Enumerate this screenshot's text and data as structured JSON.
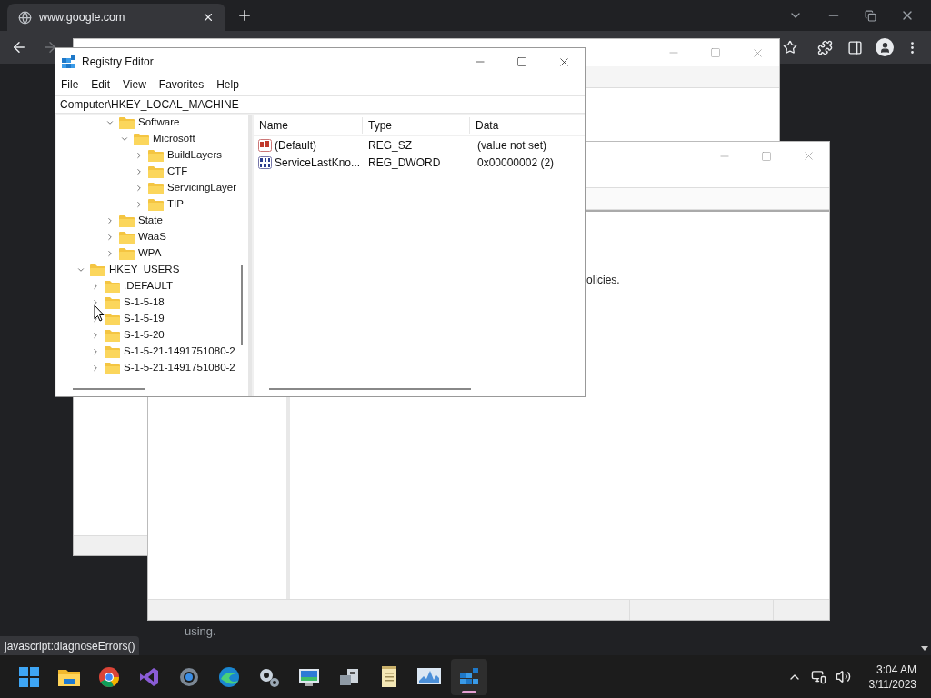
{
  "browser": {
    "tab": {
      "title": "www.google.com"
    },
    "forward_disabled": true,
    "page_text": "using.",
    "status_text": "javascript:diagnoseErrors()"
  },
  "back_window": {
    "text": "olicies."
  },
  "registry_editor": {
    "title": "Registry Editor",
    "menu": [
      "File",
      "Edit",
      "View",
      "Favorites",
      "Help"
    ],
    "address": "Computer\\HKEY_LOCAL_MACHINE",
    "tree": {
      "scrolled_branch": [
        {
          "label": "Software",
          "expanded": true,
          "children": [
            {
              "label": "Microsoft",
              "expanded": true,
              "children": [
                {
                  "label": "BuildLayers",
                  "expanded": false
                },
                {
                  "label": "CTF",
                  "expanded": false
                },
                {
                  "label": "ServicingLayer",
                  "expanded": false
                },
                {
                  "label": "TIP",
                  "expanded": false
                }
              ]
            }
          ]
        },
        {
          "label": "State",
          "expanded": false
        },
        {
          "label": "WaaS",
          "expanded": false
        },
        {
          "label": "WPA",
          "expanded": false
        }
      ],
      "roots": [
        {
          "label": "HKEY_USERS",
          "expanded": true,
          "children": [
            {
              "label": ".DEFAULT",
              "expanded": false
            },
            {
              "label": "S-1-5-18",
              "expanded": false
            },
            {
              "label": "S-1-5-19",
              "expanded": false
            },
            {
              "label": "S-1-5-20",
              "expanded": false
            },
            {
              "label": "S-1-5-21-1491751080-2",
              "expanded": false
            },
            {
              "label": "S-1-5-21-1491751080-2",
              "expanded": false
            }
          ]
        }
      ]
    },
    "columns": [
      "Name",
      "Type",
      "Data"
    ],
    "values": [
      {
        "kind": "string",
        "name": "(Default)",
        "type": "REG_SZ",
        "data": "(value not set)"
      },
      {
        "kind": "binary",
        "name": "ServiceLastKno...",
        "type": "REG_DWORD",
        "data": "0x00000002 (2)"
      }
    ]
  },
  "taskbar": {
    "time": "3:04 AM",
    "date": "3/11/2023"
  }
}
